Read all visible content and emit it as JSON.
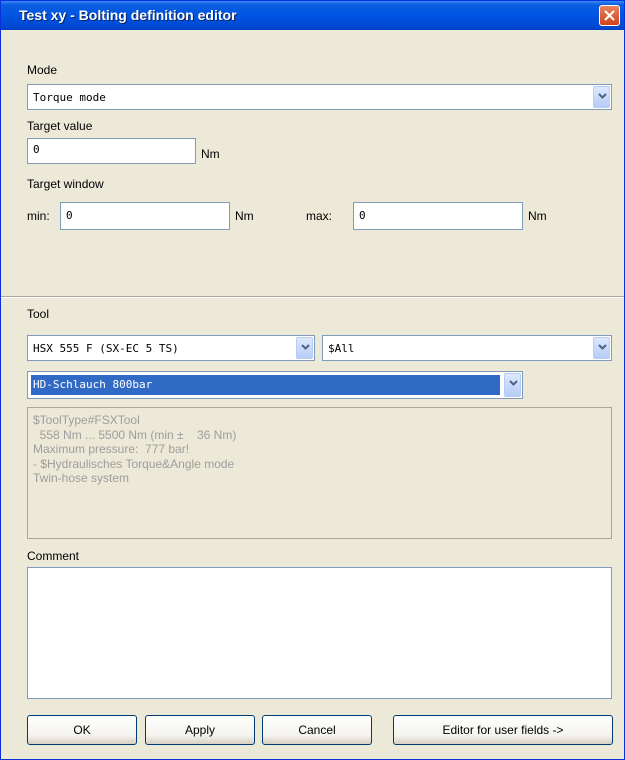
{
  "window": {
    "title": "Test xy - Bolting definition editor"
  },
  "mode": {
    "label": "Mode",
    "value": "Torque mode"
  },
  "target_value": {
    "label": "Target value",
    "value": "0",
    "unit": "Nm"
  },
  "target_window": {
    "label": "Target window",
    "min_label": "min:",
    "min_value": "0",
    "min_unit": "Nm",
    "max_label": "max:",
    "max_value": "0",
    "max_unit": "Nm"
  },
  "tool": {
    "label": "Tool",
    "tool_value": "HSX 555 F (SX-EC 5 TS)",
    "filter_value": "$All",
    "hose_value": "HD-Schlauch 800bar",
    "info_lines": [
      "$ToolType#FSXTool",
      "  558 Nm ... 5500 Nm (min ±    36 Nm)",
      "Maximum pressure:  777 bar!",
      "- $Hydraulisches Torque&Angle mode",
      "Twin-hose system"
    ]
  },
  "comment": {
    "label": "Comment",
    "value": ""
  },
  "buttons": {
    "ok": "OK",
    "apply": "Apply",
    "cancel": "Cancel",
    "user_fields": "Editor for user fields ->"
  },
  "colors": {
    "title_bar": "#0054e3",
    "dialog_bg": "#ece9d8",
    "selection": "#316ac5",
    "close": "#d0411a"
  }
}
